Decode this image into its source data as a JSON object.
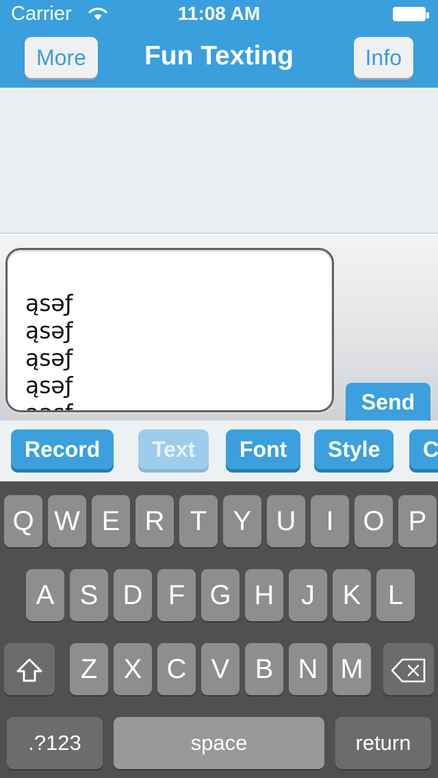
{
  "status_bar": {
    "carrier": "Carrier",
    "wifi_icon": "wifi-icon",
    "time": "11:08 AM",
    "battery_icon": "battery-full-icon"
  },
  "nav_bar": {
    "title": "Fun Texting",
    "left_button": "More",
    "right_button": "Info",
    "background_color": "#3aa0dd"
  },
  "message_area": {
    "background_color": "#ebeef0",
    "messages": []
  },
  "input_bar": {
    "text_lines": [
      "ąsəƒ",
      "ąsəƒ",
      "ąsəƒ",
      "ąsəƒ",
      "ąəsƒ"
    ],
    "placeholder": "",
    "caret_visible": true,
    "send_button": "Send",
    "send_color": "#3ba0dd"
  },
  "toolbar": {
    "buttons": [
      {
        "label": "Record",
        "state": "enabled"
      },
      {
        "label": "Text",
        "state": "selected"
      },
      {
        "label": "Font",
        "state": "enabled"
      },
      {
        "label": "Style",
        "state": "enabled"
      },
      {
        "label": "Cl",
        "state": "enabled"
      }
    ]
  },
  "keyboard": {
    "background_color": "#4f5051",
    "key_color": "#8e8e90",
    "row1": [
      "Q",
      "W",
      "E",
      "R",
      "T",
      "Y",
      "U",
      "I",
      "O",
      "P"
    ],
    "row2": [
      "A",
      "S",
      "D",
      "F",
      "G",
      "H",
      "J",
      "K",
      "L"
    ],
    "row3": [
      "Z",
      "X",
      "C",
      "V",
      "B",
      "N",
      "M"
    ],
    "shift_icon": "shift-arrow-icon",
    "delete_icon": "delete-backspace-icon",
    "numeric_key": ".?123",
    "space_key": "space",
    "return_key": "return"
  }
}
